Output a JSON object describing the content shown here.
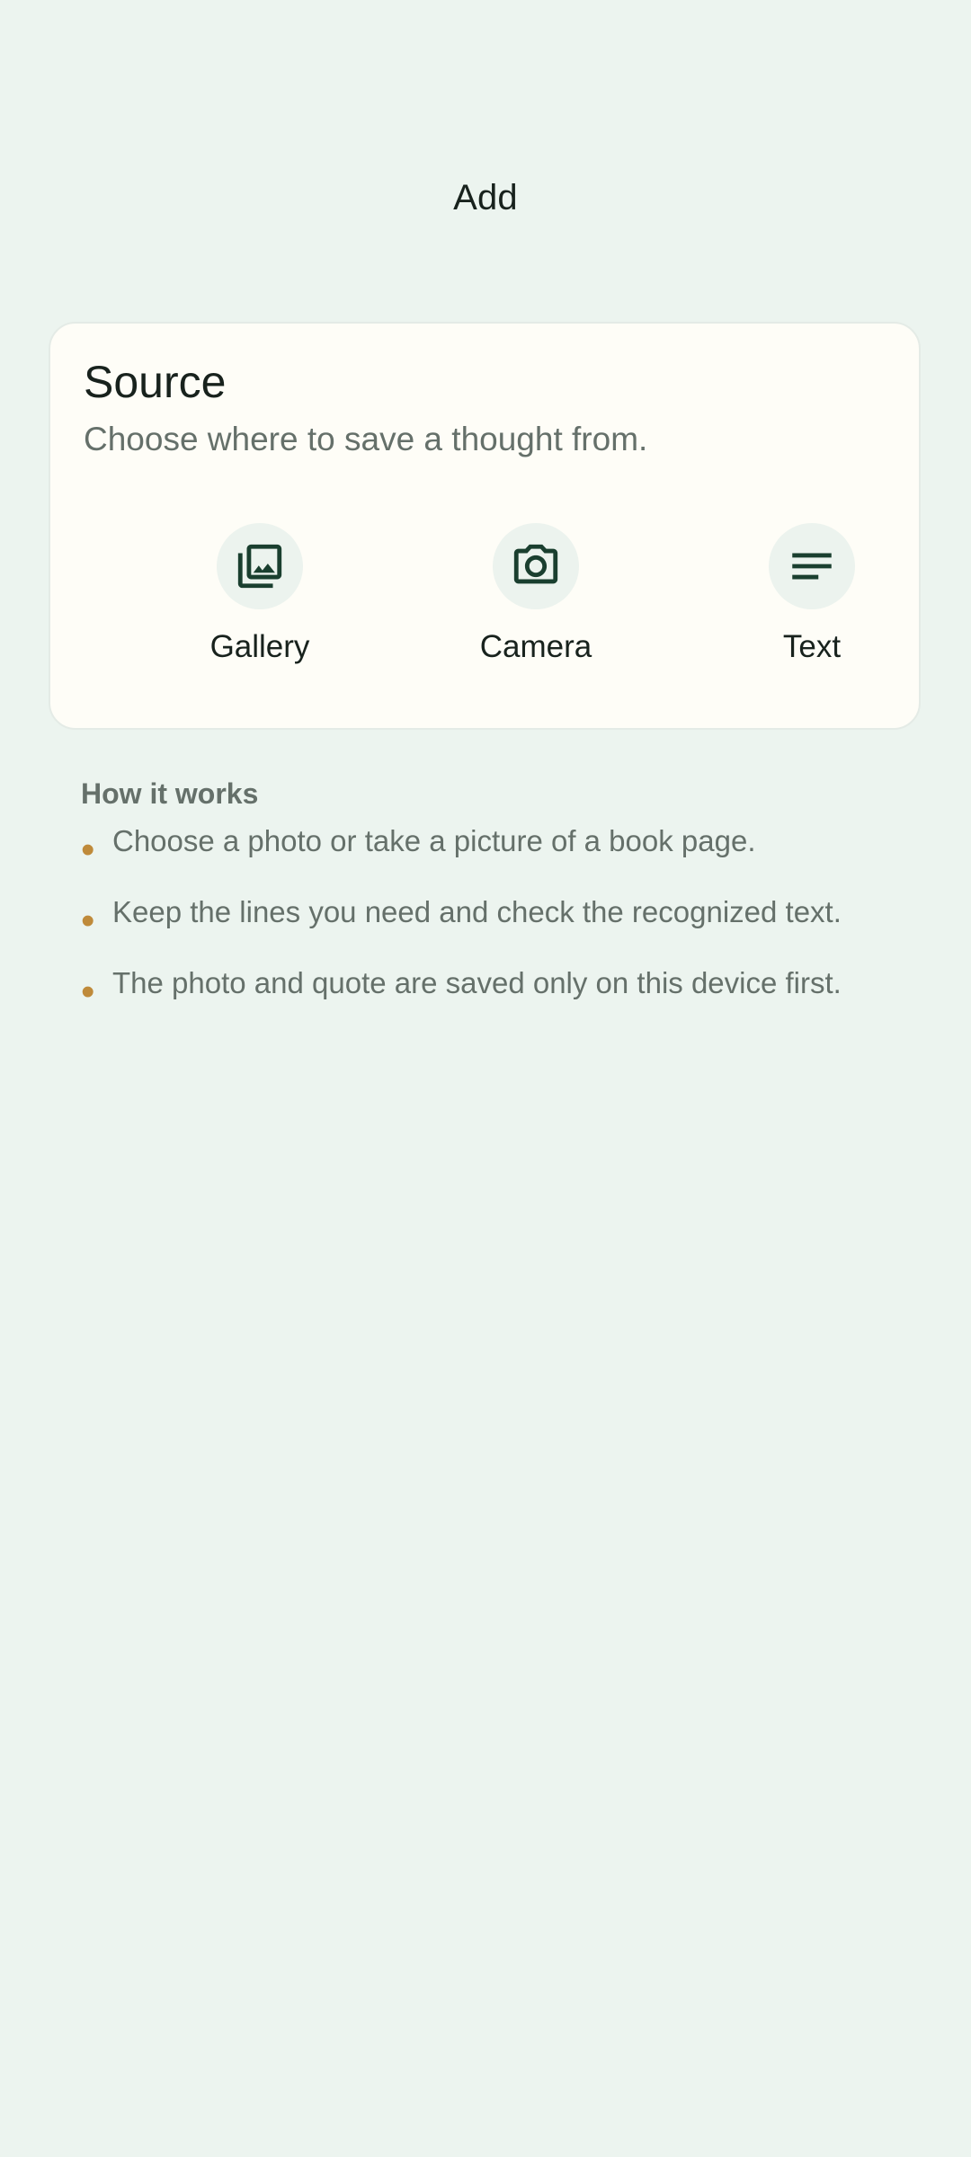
{
  "header": {
    "title": "Add"
  },
  "source_card": {
    "title": "Source",
    "subtitle": "Choose where to save a thought from.",
    "options": [
      {
        "label": "Gallery",
        "icon": "gallery-icon"
      },
      {
        "label": "Camera",
        "icon": "camera-icon"
      },
      {
        "label": "Text",
        "icon": "text-lines-icon"
      }
    ]
  },
  "how_it_works": {
    "title": "How it works",
    "bullet": "•",
    "items": [
      "Choose a photo or take a picture of a book page.",
      "Keep the lines you need and check the recognized text.",
      "The photo and quote are saved only on this device first."
    ]
  },
  "colors": {
    "background": "#ECF4EF",
    "card": "#FEFDF7",
    "icon": "#1A3F2F",
    "icon_circle": "#ECF3EE",
    "bullet": "#BF8A3A",
    "secondary_text": "#65706A",
    "primary_text": "#18221D"
  }
}
